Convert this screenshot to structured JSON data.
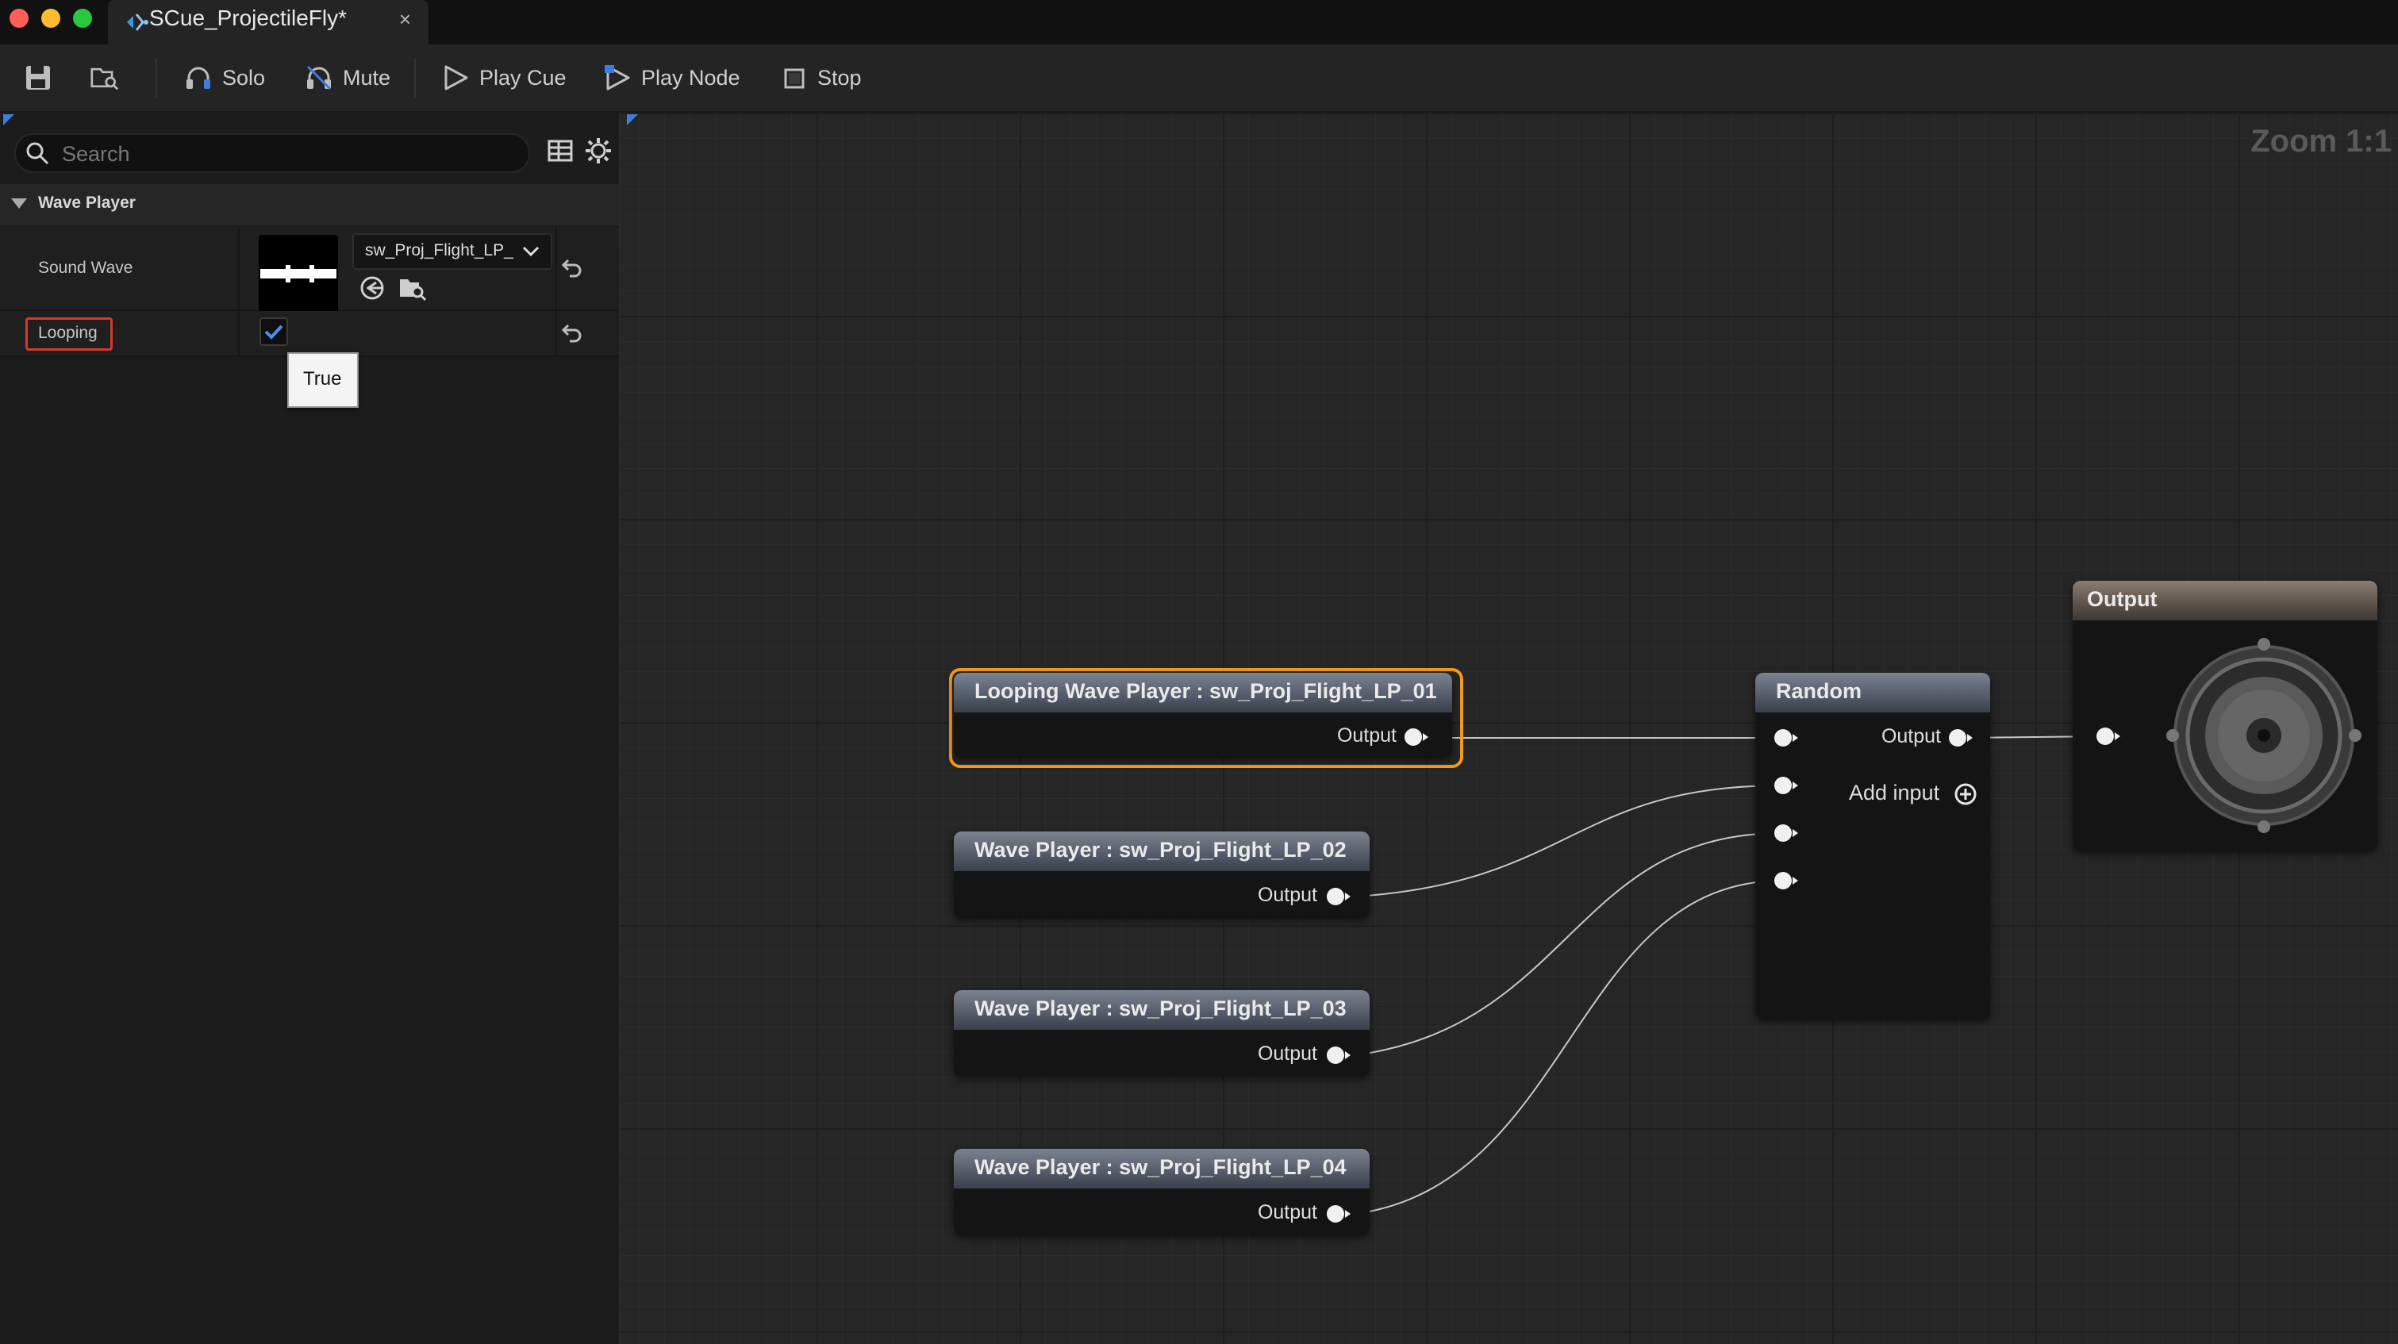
{
  "window": {
    "tab_title": "SCue_ProjectileFly*",
    "close_glyph": "×"
  },
  "toolbar": {
    "solo_label": "Solo",
    "mute_label": "Mute",
    "play_cue_label": "Play Cue",
    "play_node_label": "Play Node",
    "stop_label": "Stop"
  },
  "details": {
    "search_placeholder": "Search",
    "category_label": "Wave Player",
    "sound_wave_label": "Sound Wave",
    "sound_wave_value": "sw_Proj_Flight_LP_",
    "looping_label": "Looping",
    "looping_checked": true,
    "tooltip_text": "True"
  },
  "graph": {
    "zoom_label": "Zoom 1:1",
    "nodes": {
      "wp1_title": "Looping Wave Player : sw_Proj_Flight_LP_01",
      "wp2_title": "Wave Player : sw_Proj_Flight_LP_02",
      "wp3_title": "Wave Player : sw_Proj_Flight_LP_03",
      "wp4_title": "Wave Player : sw_Proj_Flight_LP_04",
      "random_title": "Random",
      "output_title": "Output",
      "output_pin_label": "Output",
      "add_input_label": "Add input"
    }
  },
  "colors": {
    "selection": "#f29a1f",
    "accent_blue": "#3d7de0",
    "highlight_red": "#d23a2a"
  }
}
